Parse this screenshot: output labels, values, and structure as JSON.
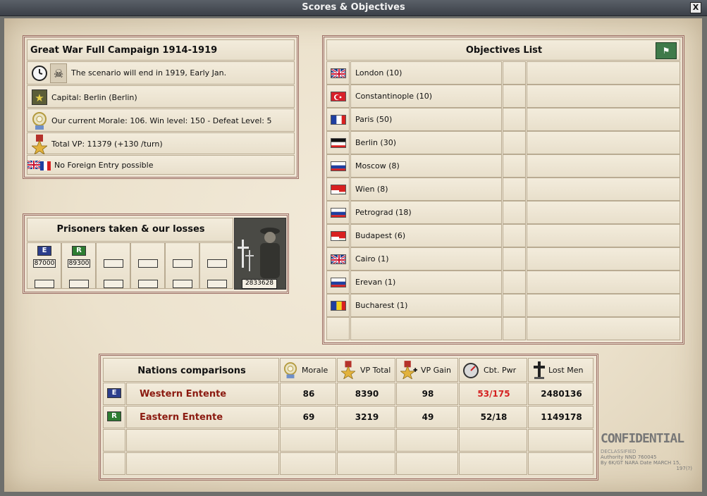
{
  "window": {
    "title": "Scores & Objectives",
    "close": "X"
  },
  "scenario": {
    "title": "Great War Full Campaign 1914-1919",
    "end_text": "The scenario will end in 1919, Early Jan.",
    "capital": "Capital: Berlin (Berlin)",
    "morale": "Our current Morale: 106. Win level: 150 - Defeat Level: 5",
    "vp": "Total VP: 11379 (+130 /turn)",
    "foreign": "No Foreign Entry possible"
  },
  "prisoners": {
    "title": "Prisoners taken & our losses",
    "entries": [
      {
        "badge": "E",
        "value": "87000"
      },
      {
        "badge": "R",
        "value": "89300"
      }
    ],
    "our_losses": "2833628"
  },
  "objectives": {
    "title": "Objectives List",
    "items": [
      {
        "name": "London (10)",
        "flag": "uk"
      },
      {
        "name": "Constantinople (10)",
        "flag": "turkey"
      },
      {
        "name": "Paris (50)",
        "flag": "france"
      },
      {
        "name": "Berlin (30)",
        "flag": "germany"
      },
      {
        "name": "Moscow (8)",
        "flag": "russia"
      },
      {
        "name": "Wien (8)",
        "flag": "austria"
      },
      {
        "name": "Petrograd (18)",
        "flag": "russia"
      },
      {
        "name": "Budapest (6)",
        "flag": "austria"
      },
      {
        "name": "Cairo (1)",
        "flag": "uk"
      },
      {
        "name": "Erevan (1)",
        "flag": "russia"
      },
      {
        "name": "Bucharest (1)",
        "flag": "romania"
      }
    ]
  },
  "nations": {
    "title": "Nations comparisons",
    "columns": [
      "Morale",
      "VP Total",
      "VP Gain",
      "Cbt. Pwr",
      "Lost Men"
    ],
    "rows": [
      {
        "badge": "E",
        "name": "Western Entente",
        "morale": "86",
        "vp_total": "8390",
        "vp_gain": "98",
        "cbt_pwr": "53/175",
        "lost_men": "2480136"
      },
      {
        "badge": "R",
        "name": "Eastern Entente",
        "morale": "69",
        "vp_total": "3219",
        "vp_gain": "49",
        "cbt_pwr": "52/18",
        "lost_men": "1149178"
      }
    ]
  },
  "stamp": {
    "word": "CONFIDENTIAL",
    "lines": [
      "DECLASSIFIED",
      "Authority NND 760045",
      "By 6K/GT  NARA Date MARCH 15,",
      "197(?)"
    ]
  },
  "colors": {
    "nation_name": "#8b1a10",
    "cbt_pwr_warn": "#d42020",
    "panel_border": "#9a6b62",
    "badge_e": "#2c3e8c",
    "badge_r": "#2e7d32"
  }
}
